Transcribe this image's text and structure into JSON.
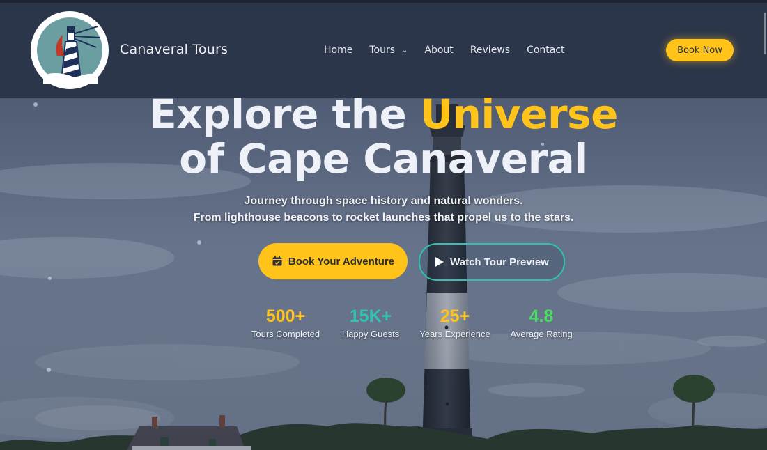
{
  "brand": {
    "name": "Canaveral Tours"
  },
  "nav": {
    "items": [
      {
        "label": "Home"
      },
      {
        "label": "Tours",
        "has_dropdown": true
      },
      {
        "label": "About"
      },
      {
        "label": "Reviews"
      },
      {
        "label": "Contact"
      }
    ],
    "cta_label": "Book Now"
  },
  "hero": {
    "headline_part1": "Explore the ",
    "headline_accent": "Universe",
    "headline_line2": "of Cape Canaveral",
    "subtitle_line1": "Journey through space history and natural wonders.",
    "subtitle_line2": "From lighthouse beacons to rocket launches that propel us to the stars.",
    "primary_button": {
      "label": "Book Your Adventure",
      "icon": "calendar-check-icon"
    },
    "secondary_button": {
      "label": "Watch Tour Preview",
      "icon": "play-icon"
    }
  },
  "stats": [
    {
      "value": "500+",
      "label": "Tours Completed",
      "color": "#ffc31a"
    },
    {
      "value": "15K+",
      "label": "Happy Guests",
      "color": "#2fc3b0"
    },
    {
      "value": "25+",
      "label": "Years Experience",
      "color": "#ffc31a"
    },
    {
      "value": "4.8",
      "label": "Average Rating",
      "color": "#4cd964"
    }
  ],
  "colors": {
    "accent": "#ffc31a",
    "teal": "#2fc3b0",
    "header_bg": "#2a3448"
  }
}
